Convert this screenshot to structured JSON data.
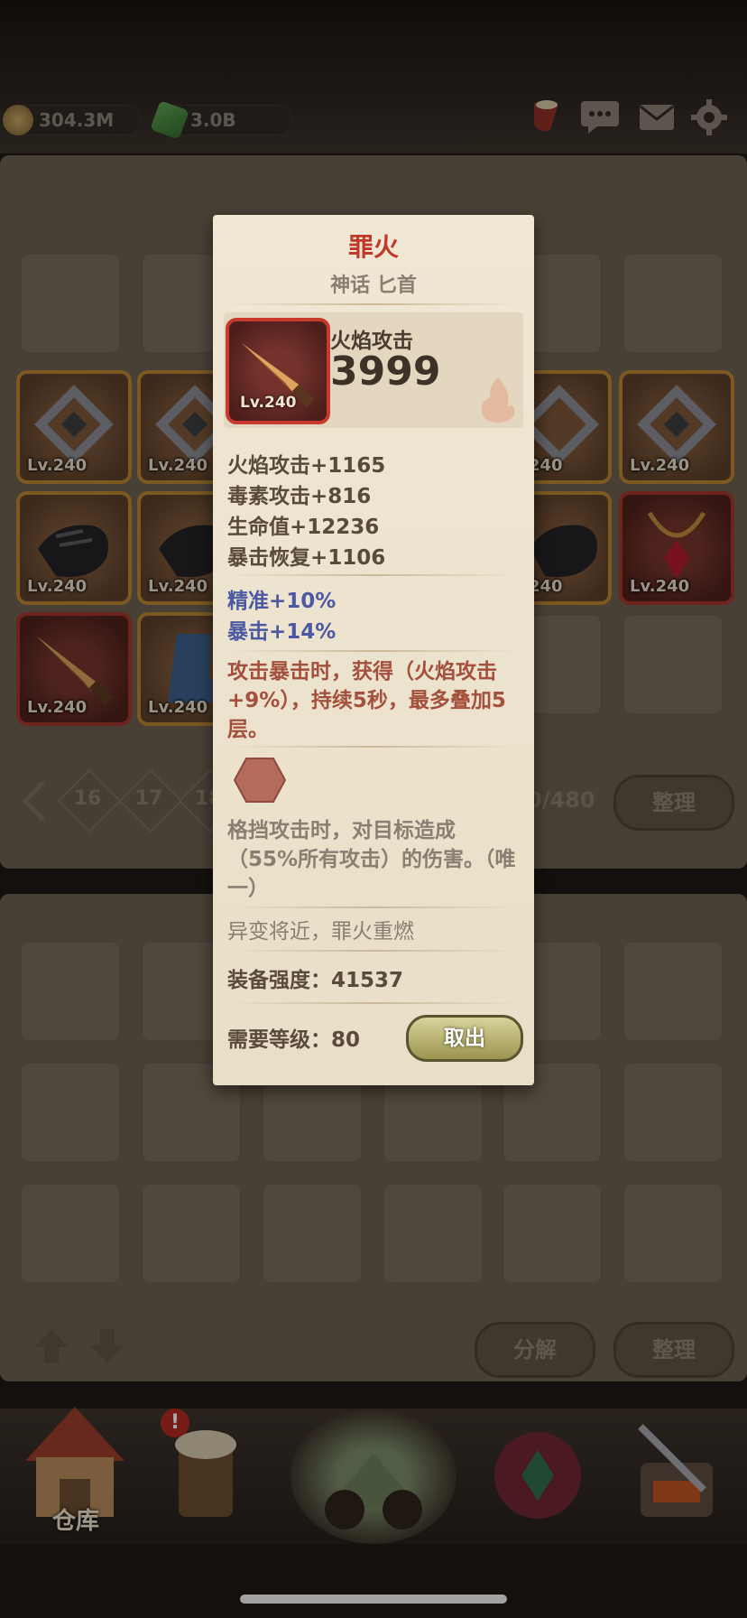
{
  "currencies": {
    "gold": "304.3M",
    "gems": "3.0B"
  },
  "inventory": {
    "pages": [
      "16",
      "17",
      "18"
    ],
    "capacity": "0/480",
    "sort_label": "整理",
    "items": [
      {
        "level": "Lv.240"
      },
      {
        "level": "Lv.240"
      },
      {
        "level": "240"
      },
      {
        "level": "Lv.240"
      },
      {
        "level": "Lv.240"
      },
      {
        "level": "Lv.240"
      },
      {
        "level": "240"
      },
      {
        "level": "Lv.240"
      },
      {
        "level": "Lv.240"
      },
      {
        "level": "Lv.240"
      }
    ]
  },
  "bag": {
    "decompose_label": "分解",
    "sort_label": "整理"
  },
  "nav": {
    "warehouse_label": "仓库",
    "alert": "!"
  },
  "tooltip": {
    "name": "罪火",
    "subtitle": "神话 匕首",
    "item_level": "Lv.240",
    "main_stat_name": "火焰攻击",
    "main_stat_value": "3999",
    "stats": [
      "火焰攻击+1165",
      "毒素攻击+816",
      "生命值+12236",
      "暴击恢复+1106"
    ],
    "bonus_stats": [
      "精准+10%",
      "暴击+14%"
    ],
    "effect": "攻击暴击时，获得（火焰攻击+9%），持续5秒，最多叠加5层。",
    "socket_effect": "格挡攻击时，对目标造成（55%所有攻击）的伤害。（唯一）",
    "flavor": "异变将近，罪火重燃",
    "power_label": "装备强度：41537",
    "req_label": "需要等级：80",
    "take_label": "取出"
  },
  "colors": {
    "rarity_red": "#c0392b",
    "stat_blue": "#4d58a3",
    "effect_red": "#a3503c"
  }
}
